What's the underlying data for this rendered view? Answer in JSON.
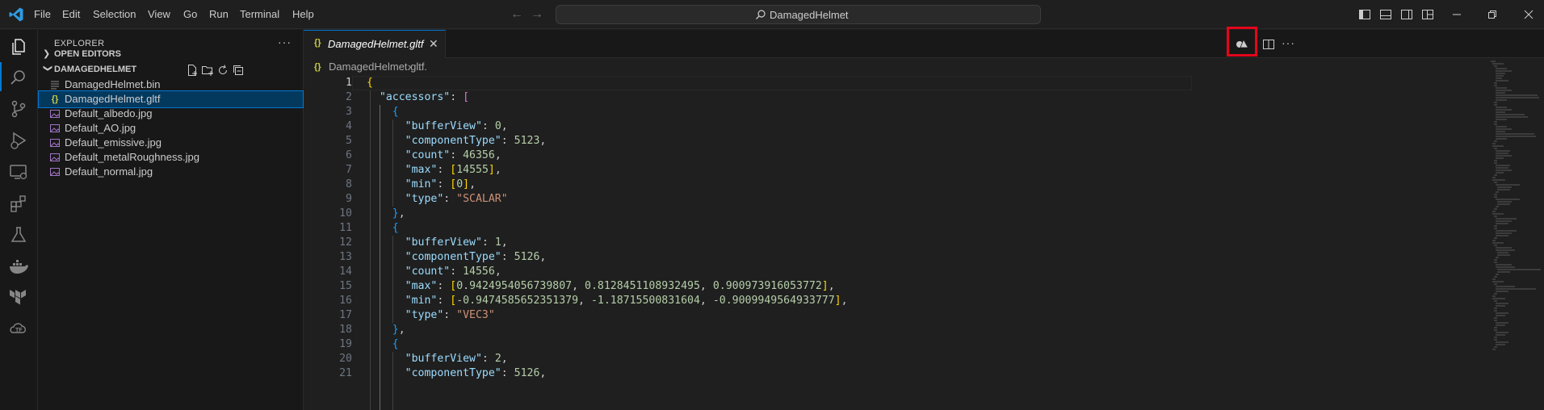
{
  "app": {
    "accent_color": "#0078d4",
    "menu": [
      "File",
      "Edit",
      "Selection",
      "View",
      "Go",
      "Run",
      "Terminal",
      "Help"
    ],
    "command_center": "DamagedHelmet",
    "window_controls": [
      "minimize-icon",
      "restore-icon",
      "close-icon"
    ]
  },
  "activity_bar": [
    "explorer-icon",
    "search-icon",
    "source-control-icon",
    "run-debug-icon",
    "remote-explorer-icon",
    "extensions-icon",
    "testing-icon",
    "docker-icon",
    "terraform-icon",
    "terraform-cloud-icon"
  ],
  "sidebar": {
    "title": "EXPLORER",
    "more": "···",
    "open_editors": "OPEN EDITORS",
    "folder": "DAMAGEDHELMET",
    "files": [
      {
        "name": "DamagedHelmet.bin",
        "icon": "lines-file-icon"
      },
      {
        "name": "DamagedHelmet.gltf",
        "icon": "json-braces-icon",
        "selected": true
      },
      {
        "name": "Default_albedo.jpg",
        "icon": "image-file-icon"
      },
      {
        "name": "Default_AO.jpg",
        "icon": "image-file-icon"
      },
      {
        "name": "Default_emissive.jpg",
        "icon": "image-file-icon"
      },
      {
        "name": "Default_metalRoughness.jpg",
        "icon": "image-file-icon"
      },
      {
        "name": "Default_normal.jpg",
        "icon": "image-file-icon"
      }
    ]
  },
  "editor": {
    "tab": {
      "label": "DamagedHelmet.gltf",
      "icon": "{}",
      "close": "✕"
    },
    "breadcrumb": {
      "file": "DamagedHelmet.gltf",
      "sep": "›",
      "more": "..."
    },
    "more": "···",
    "highlight_color": "#e3061b",
    "lines": [
      [
        {
          "t": "{",
          "c": "b1"
        }
      ],
      [
        {
          "t": "  "
        },
        {
          "t": "\"accessors\"",
          "c": "k"
        },
        {
          "t": ": "
        },
        {
          "t": "[",
          "c": "b2"
        }
      ],
      [
        {
          "t": "    "
        },
        {
          "t": "{",
          "c": "b3"
        }
      ],
      [
        {
          "t": "      "
        },
        {
          "t": "\"bufferView\"",
          "c": "k"
        },
        {
          "t": ": "
        },
        {
          "t": "0",
          "c": "n"
        },
        {
          "t": ","
        }
      ],
      [
        {
          "t": "      "
        },
        {
          "t": "\"componentType\"",
          "c": "k"
        },
        {
          "t": ": "
        },
        {
          "t": "5123",
          "c": "n"
        },
        {
          "t": ","
        }
      ],
      [
        {
          "t": "      "
        },
        {
          "t": "\"count\"",
          "c": "k"
        },
        {
          "t": ": "
        },
        {
          "t": "46356",
          "c": "n"
        },
        {
          "t": ","
        }
      ],
      [
        {
          "t": "      "
        },
        {
          "t": "\"max\"",
          "c": "k"
        },
        {
          "t": ": "
        },
        {
          "t": "[",
          "c": "b1"
        },
        {
          "t": "14555",
          "c": "n"
        },
        {
          "t": "]",
          "c": "b1"
        },
        {
          "t": ","
        }
      ],
      [
        {
          "t": "      "
        },
        {
          "t": "\"min\"",
          "c": "k"
        },
        {
          "t": ": "
        },
        {
          "t": "[",
          "c": "b1"
        },
        {
          "t": "0",
          "c": "n"
        },
        {
          "t": "]",
          "c": "b1"
        },
        {
          "t": ","
        }
      ],
      [
        {
          "t": "      "
        },
        {
          "t": "\"type\"",
          "c": "k"
        },
        {
          "t": ": "
        },
        {
          "t": "\"SCALAR\"",
          "c": "s"
        }
      ],
      [
        {
          "t": "    "
        },
        {
          "t": "}",
          "c": "b3"
        },
        {
          "t": ","
        }
      ],
      [
        {
          "t": "    "
        },
        {
          "t": "{",
          "c": "b3"
        }
      ],
      [
        {
          "t": "      "
        },
        {
          "t": "\"bufferView\"",
          "c": "k"
        },
        {
          "t": ": "
        },
        {
          "t": "1",
          "c": "n"
        },
        {
          "t": ","
        }
      ],
      [
        {
          "t": "      "
        },
        {
          "t": "\"componentType\"",
          "c": "k"
        },
        {
          "t": ": "
        },
        {
          "t": "5126",
          "c": "n"
        },
        {
          "t": ","
        }
      ],
      [
        {
          "t": "      "
        },
        {
          "t": "\"count\"",
          "c": "k"
        },
        {
          "t": ": "
        },
        {
          "t": "14556",
          "c": "n"
        },
        {
          "t": ","
        }
      ],
      [
        {
          "t": "      "
        },
        {
          "t": "\"max\"",
          "c": "k"
        },
        {
          "t": ": "
        },
        {
          "t": "[",
          "c": "b1"
        },
        {
          "t": "0.9424954056739807",
          "c": "n"
        },
        {
          "t": ", "
        },
        {
          "t": "0.8128451108932495",
          "c": "n"
        },
        {
          "t": ", "
        },
        {
          "t": "0.900973916053772",
          "c": "n"
        },
        {
          "t": "]",
          "c": "b1"
        },
        {
          "t": ","
        }
      ],
      [
        {
          "t": "      "
        },
        {
          "t": "\"min\"",
          "c": "k"
        },
        {
          "t": ": "
        },
        {
          "t": "[",
          "c": "b1"
        },
        {
          "t": "-0.9474585652351379",
          "c": "n"
        },
        {
          "t": ", "
        },
        {
          "t": "-1.18715500831604",
          "c": "n"
        },
        {
          "t": ", "
        },
        {
          "t": "-0.9009949564933777",
          "c": "n"
        },
        {
          "t": "]",
          "c": "b1"
        },
        {
          "t": ","
        }
      ],
      [
        {
          "t": "      "
        },
        {
          "t": "\"type\"",
          "c": "k"
        },
        {
          "t": ": "
        },
        {
          "t": "\"VEC3\"",
          "c": "s"
        }
      ],
      [
        {
          "t": "    "
        },
        {
          "t": "}",
          "c": "b3"
        },
        {
          "t": ","
        }
      ],
      [
        {
          "t": "    "
        },
        {
          "t": "{",
          "c": "b3"
        }
      ],
      [
        {
          "t": "      "
        },
        {
          "t": "\"bufferView\"",
          "c": "k"
        },
        {
          "t": ": "
        },
        {
          "t": "2",
          "c": "n"
        },
        {
          "t": ","
        }
      ],
      [
        {
          "t": "      "
        },
        {
          "t": "\"componentType\"",
          "c": "k"
        },
        {
          "t": ": "
        },
        {
          "t": "5126",
          "c": "n"
        },
        {
          "t": ","
        }
      ]
    ]
  }
}
